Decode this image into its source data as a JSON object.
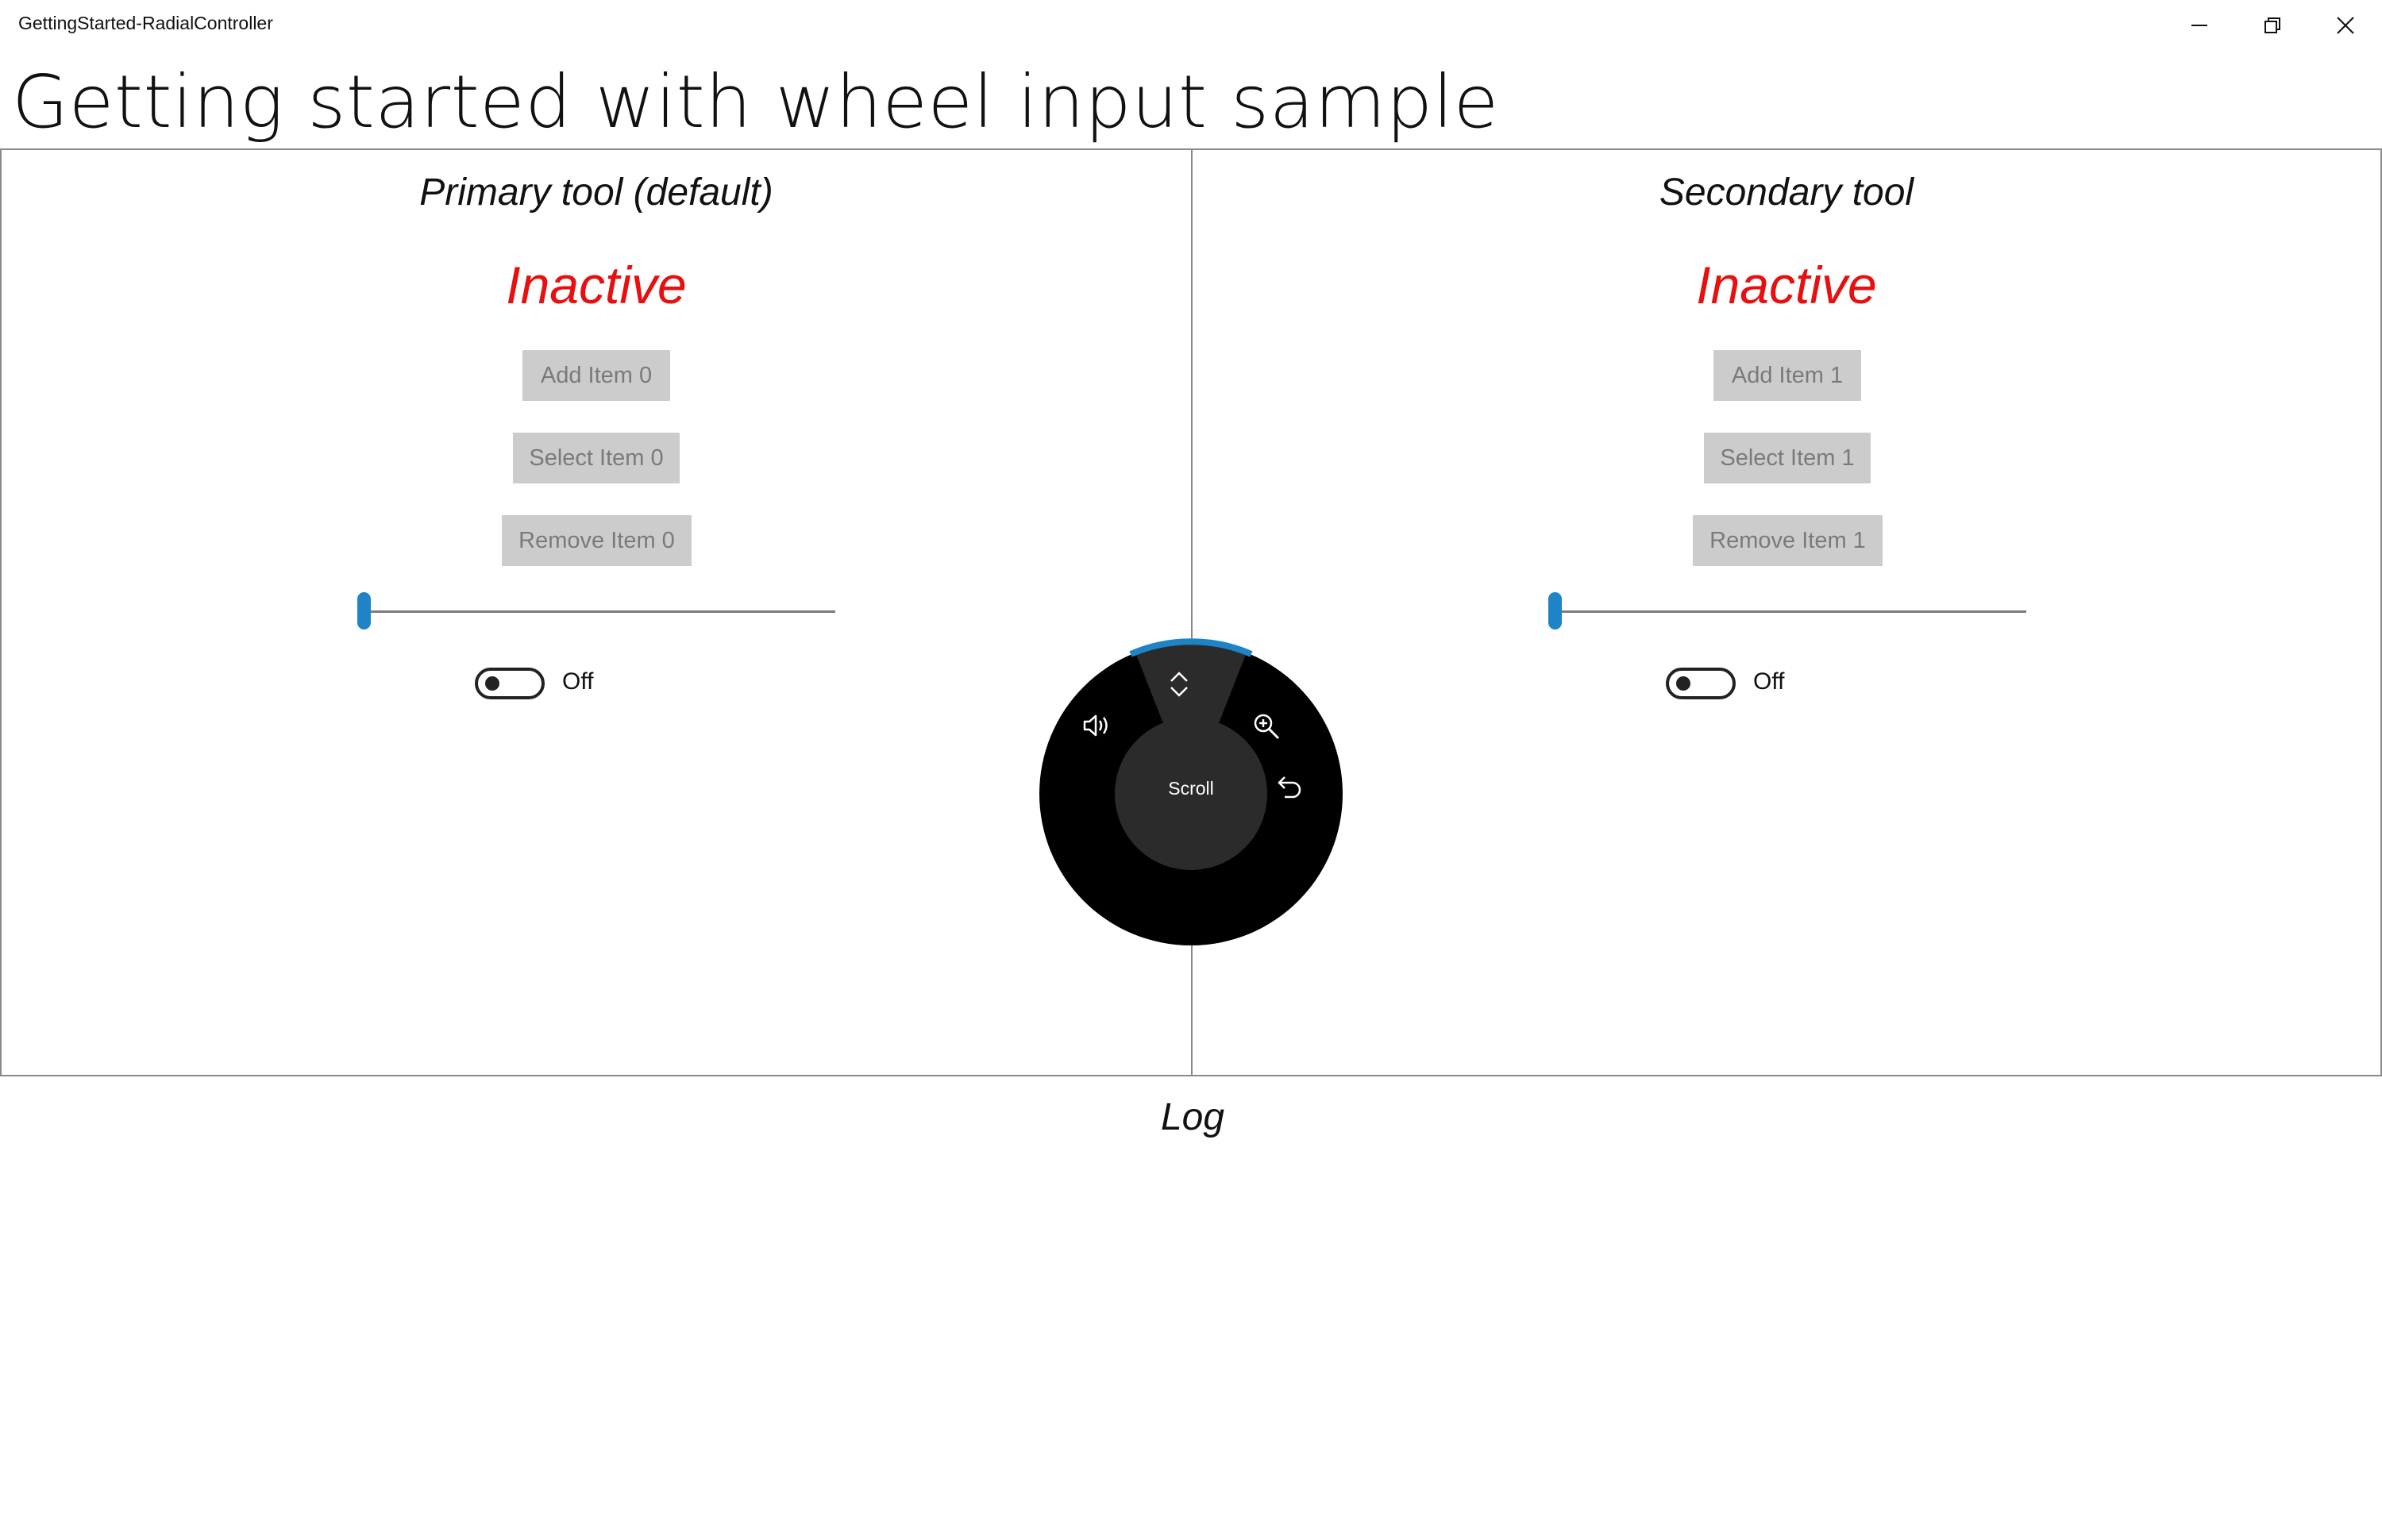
{
  "window": {
    "title": "GettingStarted-RadialController"
  },
  "page": {
    "title": "Getting started with wheel input sample"
  },
  "primary": {
    "title": "Primary tool (default)",
    "status": "Inactive",
    "add_label": "Add Item 0",
    "select_label": "Select Item 0",
    "remove_label": "Remove Item 0",
    "slider_value": 0,
    "toggle_state": "Off"
  },
  "secondary": {
    "title": "Secondary tool",
    "status": "Inactive",
    "add_label": "Add Item 1",
    "select_label": "Select Item 1",
    "remove_label": "Remove Item 1",
    "slider_value": 0,
    "toggle_state": "Off"
  },
  "radial_menu": {
    "center_label": "Scroll",
    "items": [
      {
        "name": "volume-icon",
        "label": "Volume"
      },
      {
        "name": "scroll-icon",
        "label": "Scroll",
        "selected": true
      },
      {
        "name": "zoom-icon",
        "label": "Zoom"
      },
      {
        "name": "undo-icon",
        "label": "Undo"
      }
    ],
    "accent_color": "#1f84c7"
  },
  "log": {
    "title": "Log"
  },
  "colors": {
    "status_inactive": "#e8100f",
    "button_bg": "#cccccc",
    "slider_accent": "#1f84c7"
  }
}
